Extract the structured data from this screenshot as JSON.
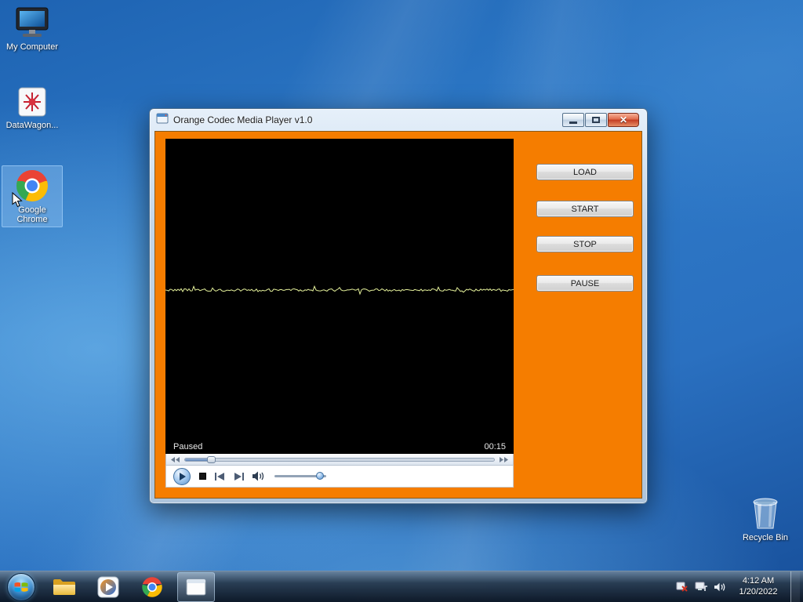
{
  "colors": {
    "window_client_orange": "#F57D00",
    "close_button_red": "#C33C22",
    "wallpaper_blue": "#2A70C0"
  },
  "desktop": {
    "icons": {
      "my_computer": "My Computer",
      "datawagon": "DataWagon...",
      "chrome": "Google Chrome",
      "recycle_bin": "Recycle Bin"
    }
  },
  "window": {
    "title": "Orange Codec Media Player v1.0",
    "player": {
      "status": "Paused",
      "time": "00:15"
    },
    "side_buttons": [
      "LOAD",
      "START",
      "STOP",
      "PAUSE"
    ]
  },
  "taskbar": {
    "clock": {
      "time": "4:12 AM",
      "date": "1/20/2022"
    }
  }
}
